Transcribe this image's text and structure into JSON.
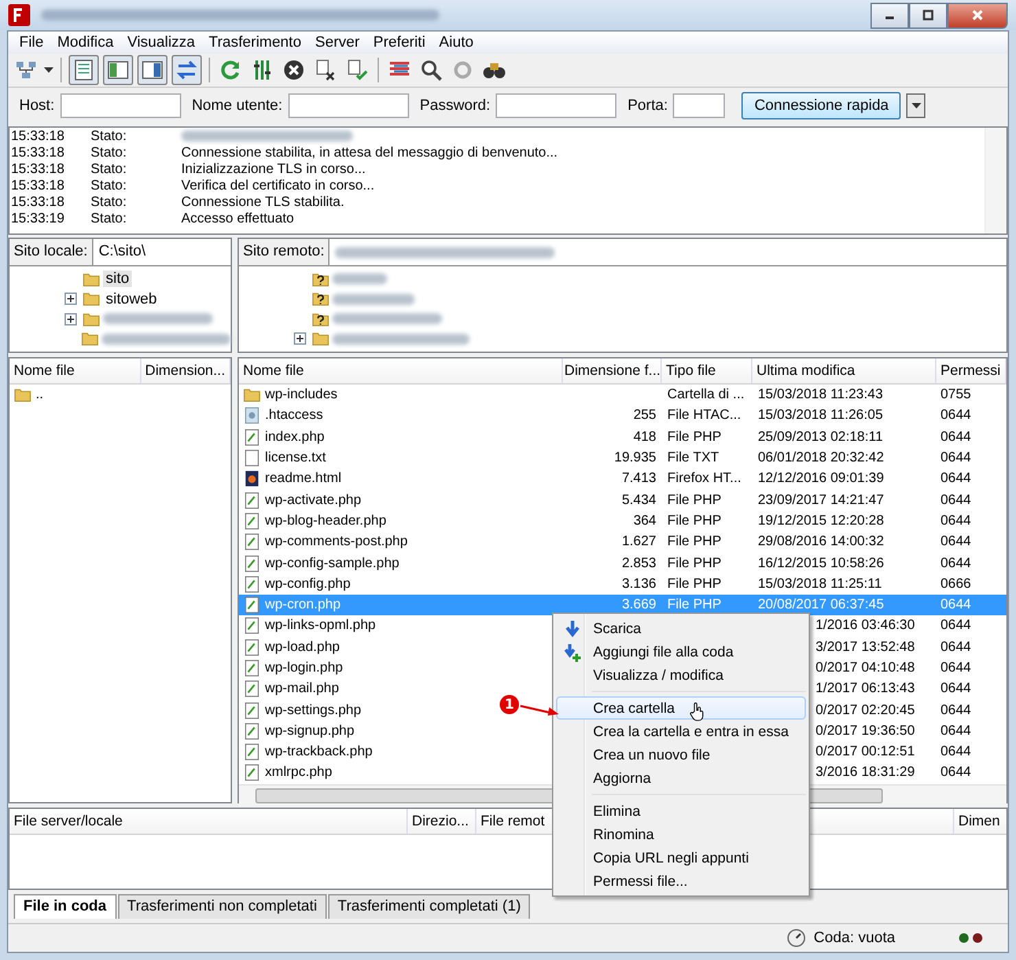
{
  "menu": [
    "File",
    "Modifica",
    "Visualizza",
    "Trasferimento",
    "Server",
    "Preferiti",
    "Aiuto"
  ],
  "quickconnect": {
    "fields": [
      {
        "label": "Host:"
      },
      {
        "label": "Nome utente:"
      },
      {
        "label": "Password:"
      },
      {
        "label": "Porta:"
      }
    ],
    "button": "Connessione rapida"
  },
  "log": [
    {
      "time": "15:33:18",
      "type": "Stato:"
    },
    {
      "time": "15:33:18",
      "type": "Stato:",
      "message": "Connessione stabilita, in attesa del messaggio di benvenuto..."
    },
    {
      "time": "15:33:18",
      "type": "Stato:",
      "message": "Inizializzazione TLS in corso..."
    },
    {
      "time": "15:33:18",
      "type": "Stato:",
      "message": "Verifica del certificato in corso..."
    },
    {
      "time": "15:33:18",
      "type": "Stato:",
      "message": "Connessione TLS stabilita."
    },
    {
      "time": "15:33:19",
      "type": "Stato:",
      "message": "Accesso effettuato"
    }
  ],
  "local_site": {
    "label": "Sito locale:",
    "path": "C:\\sito\\",
    "tree": [
      {
        "name": "sito",
        "expandable": false,
        "kind": "folder",
        "selected": true
      },
      {
        "name": "sitoweb",
        "expandable": true,
        "kind": "folder",
        "selected": false
      },
      {
        "expandable": true,
        "kind": "folder",
        "selected": false
      },
      {
        "expandable": false,
        "kind": "folder",
        "selected": false
      }
    ]
  },
  "remote_site": {
    "label": "Sito remoto:",
    "tree": [
      {
        "expandable": false,
        "kind": "unknown",
        "selected": false
      },
      {
        "expandable": false,
        "kind": "unknown",
        "selected": false
      },
      {
        "expandable": false,
        "kind": "unknown",
        "selected": false
      },
      {
        "expandable": true,
        "kind": "folder",
        "selected": false
      }
    ]
  },
  "local_files": {
    "columns": [
      "Nome file",
      "Dimension..."
    ],
    "rows": [
      {
        "name": "..",
        "kind": "folder"
      }
    ]
  },
  "remote_files": {
    "columns": [
      "Nome file",
      "Dimensione f...",
      "Tipo file",
      "Ultima modifica",
      "Permessi"
    ],
    "rows": [
      {
        "name": "wp-includes",
        "kind": "folder",
        "type": "Cartella di ...",
        "modified": "15/03/2018 11:23:43",
        "permissions": "0755",
        "selected": false
      },
      {
        "name": ".htaccess",
        "kind": "config",
        "size": "255",
        "type": "File HTAC...",
        "modified": "15/03/2018 11:26:05",
        "permissions": "0644",
        "selected": false
      },
      {
        "name": "index.php",
        "kind": "php",
        "size": "418",
        "type": "File PHP",
        "modified": "25/09/2013 02:18:11",
        "permissions": "0644",
        "selected": false
      },
      {
        "name": "license.txt",
        "kind": "text",
        "size": "19.935",
        "type": "File TXT",
        "modified": "06/01/2018 20:32:42",
        "permissions": "0644",
        "selected": false
      },
      {
        "name": "readme.html",
        "kind": "html",
        "size": "7.413",
        "type": "Firefox HT...",
        "modified": "12/12/2016 09:01:39",
        "permissions": "0644",
        "selected": false
      },
      {
        "name": "wp-activate.php",
        "kind": "php",
        "size": "5.434",
        "type": "File PHP",
        "modified": "23/09/2017 14:21:47",
        "permissions": "0644",
        "selected": false
      },
      {
        "name": "wp-blog-header.php",
        "kind": "php",
        "size": "364",
        "type": "File PHP",
        "modified": "19/12/2015 12:20:28",
        "permissions": "0644",
        "selected": false
      },
      {
        "name": "wp-comments-post.php",
        "kind": "php",
        "size": "1.627",
        "type": "File PHP",
        "modified": "29/08/2016 14:00:32",
        "permissions": "0644",
        "selected": false
      },
      {
        "name": "wp-config-sample.php",
        "kind": "php",
        "size": "2.853",
        "type": "File PHP",
        "modified": "16/12/2015 10:58:26",
        "permissions": "0644",
        "selected": false
      },
      {
        "name": "wp-config.php",
        "kind": "php",
        "size": "3.136",
        "type": "File PHP",
        "modified": "15/03/2018 11:25:11",
        "permissions": "0666",
        "selected": false
      },
      {
        "name": "wp-cron.php",
        "kind": "php",
        "size": "3.669",
        "type": "File PHP",
        "modified": "20/08/2017 06:37:45",
        "permissions": "0644",
        "selected": true
      },
      {
        "name": "wp-links-opml.php",
        "kind": "php",
        "modified": "1/2016 03:46:30",
        "permissions": "0644",
        "selected": false
      },
      {
        "name": "wp-load.php",
        "kind": "php",
        "modified": "3/2017 13:52:48",
        "permissions": "0644",
        "selected": false
      },
      {
        "name": "wp-login.php",
        "kind": "php",
        "modified": "0/2017 04:10:48",
        "permissions": "0644",
        "selected": false
      },
      {
        "name": "wp-mail.php",
        "kind": "php",
        "modified": "1/2017 06:13:43",
        "permissions": "0644",
        "selected": false
      },
      {
        "name": "wp-settings.php",
        "kind": "php",
        "modified": "0/2017 02:20:45",
        "permissions": "0644",
        "selected": false
      },
      {
        "name": "wp-signup.php",
        "kind": "php",
        "modified": "0/2017 19:36:50",
        "permissions": "0644",
        "selected": false
      },
      {
        "name": "wp-trackback.php",
        "kind": "php",
        "modified": "0/2017 00:12:51",
        "permissions": "0644",
        "selected": false
      },
      {
        "name": "xmlrpc.php",
        "kind": "php",
        "modified": "3/2016 18:31:29",
        "permissions": "0644",
        "selected": false
      }
    ]
  },
  "queue": {
    "columns": [
      "File server/locale",
      "Direzio...",
      "File remot",
      "Dimen"
    ]
  },
  "queue_tabs": [
    {
      "label": "File in coda",
      "selected": true
    },
    {
      "label": "Trasferimenti non completati",
      "selected": false
    },
    {
      "label": "Trasferimenti completati (1)",
      "selected": false
    }
  ],
  "status_bar": {
    "queue": "Coda: vuota"
  },
  "context_menu": {
    "items": [
      {
        "kind": "download",
        "label": "Scarica",
        "highlighted": false
      },
      {
        "kind": "enqueue",
        "label": "Aggiungi file alla coda",
        "highlighted": false
      },
      {
        "kind": "item",
        "label": "Visualizza / modifica",
        "highlighted": false
      },
      {
        "kind": "separator"
      },
      {
        "kind": "item",
        "label": "Crea cartella",
        "highlighted": true
      },
      {
        "kind": "item",
        "label": "Crea la cartella e entra in essa",
        "highlighted": false
      },
      {
        "kind": "item",
        "label": "Crea un nuovo file",
        "highlighted": false
      },
      {
        "kind": "item",
        "label": "Aggiorna",
        "highlighted": false
      },
      {
        "kind": "separator"
      },
      {
        "kind": "item",
        "label": "Elimina",
        "highlighted": false
      },
      {
        "kind": "item",
        "label": "Rinomina",
        "highlighted": false
      },
      {
        "kind": "item",
        "label": "Copia URL negli appunti",
        "highlighted": false
      },
      {
        "kind": "item",
        "label": "Permessi file...",
        "highlighted": false
      }
    ]
  },
  "callout": {
    "number": "1"
  }
}
